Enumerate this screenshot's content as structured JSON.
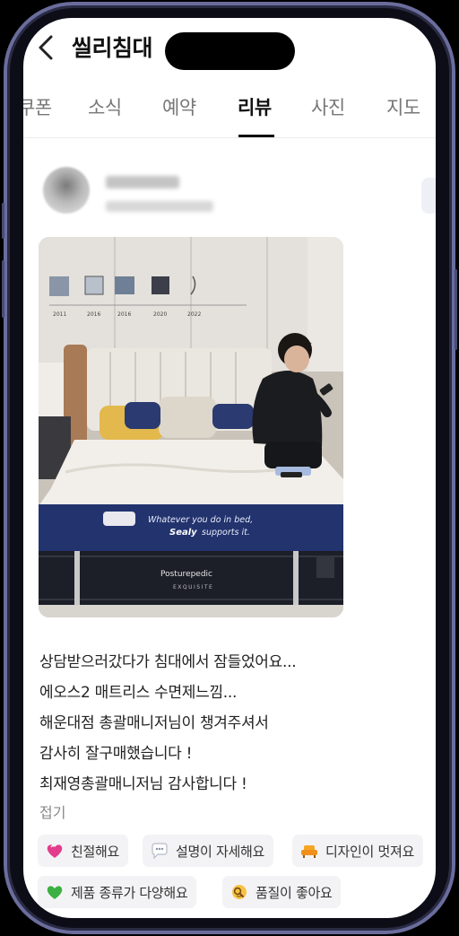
{
  "header": {
    "title": "씰리침대"
  },
  "tabs": [
    {
      "label": "쿠폰"
    },
    {
      "label": "소식"
    },
    {
      "label": "예약"
    },
    {
      "label": "리뷰",
      "active": true
    },
    {
      "label": "사진"
    },
    {
      "label": "지도"
    }
  ],
  "review": {
    "lines": [
      "상담받으러갔다가 침대에서 잠들었어요...",
      "에오스2 매트리스 수면제느낌...",
      "해운대점 총괄매니저님이 챙겨주셔서",
      "감사히 잘구매했습니다 !",
      "최재영총괄매니저님 감사합니다 !"
    ],
    "collapse_label": "접기"
  },
  "photo": {
    "wall_years": [
      "2011",
      "2016",
      "2016",
      "2020",
      "2022"
    ],
    "topper_slogan": "Whatever you do in bed,",
    "topper_brand": "Sealy",
    "topper_slogan2": "supports it.",
    "mattress_brand": "Posturepedic",
    "mattress_model": "EXQUISITE"
  },
  "keywords": [
    {
      "label": "친절해요",
      "icon": "heart-icon"
    },
    {
      "label": "설명이 자세해요",
      "icon": "speech-bubble-icon"
    },
    {
      "label": "디자인이 멋져요",
      "icon": "sofa-icon"
    },
    {
      "label": "제품 종류가 다양해요",
      "icon": "green-heart-icon"
    },
    {
      "label": "품질이 좋아요",
      "icon": "magnifier-icon"
    }
  ],
  "colors": {
    "phone_frame": "#6a6d9c",
    "topper_navy": "#22336e",
    "active_tab": "#111111"
  }
}
